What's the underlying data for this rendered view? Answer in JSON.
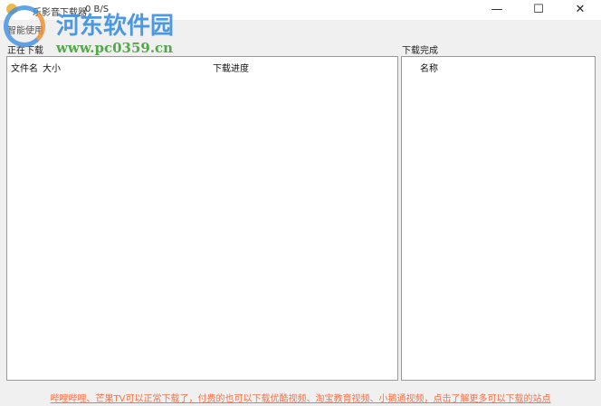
{
  "window": {
    "title": "乐影音下载器",
    "speed": "0 B/S",
    "minimize": "—",
    "maximize": "☐",
    "close": "✕"
  },
  "menu": {
    "label": "智能使用"
  },
  "downloading": {
    "label": "正在下载",
    "columns": [
      "文件名",
      "大小",
      "下载进度"
    ]
  },
  "completed": {
    "label": "下载完成",
    "columns": [
      "名称"
    ]
  },
  "footer": {
    "link": "哔哩哔哩、芒果TV可以正常下载了，付费的也可以下载优酷视频、淘宝教育视频、小鹅通视频，点击了解更多可以下载的站点"
  },
  "watermark": {
    "name": "河东软件园",
    "url": "www.pc0359.cn"
  }
}
